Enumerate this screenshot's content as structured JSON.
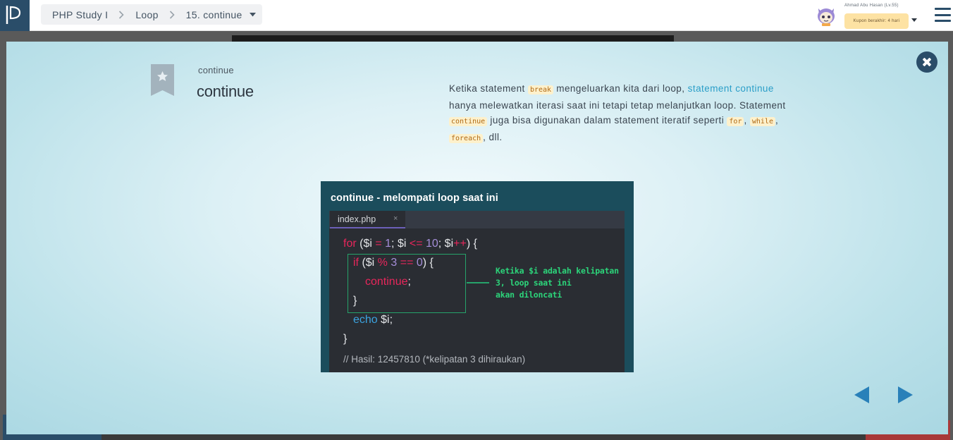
{
  "header": {
    "logo_icon": "progate-logo-icon",
    "breadcrumb": {
      "course": "PHP Study I",
      "section": "Loop",
      "lesson": "15. continue"
    },
    "user": {
      "name": "Ahmad Abu Hasan (Lv.55)",
      "coupon": "Kupon berakhir: 4 hari"
    }
  },
  "card": {
    "caption": "continue",
    "title": "continue",
    "description": {
      "p1": "Ketika statement ",
      "code_break": "break",
      "p2": " mengeluarkan kita dari loop, ",
      "link": "statement continue",
      "p3": " hanya melewatkan iterasi saat ini tetapi tetap melanjutkan loop. Statement ",
      "code_continue": "continue",
      "p4": " juga bisa digunakan dalam statement iteratif seperti ",
      "code_for": "for",
      "sep1": ", ",
      "code_while": "while",
      "sep2": ", ",
      "code_foreach": "foreach",
      "p5": ", dll."
    },
    "slide": {
      "title": "continue - melompati loop saat ini",
      "tab": "index.php",
      "tab_close": "×",
      "code": {
        "l1_for": "for",
        "l1_a": " ($i ",
        "l1_eq": "=",
        "l1_b": " ",
        "l1_1": "1",
        "l1_c": "; $i ",
        "l1_le": "<=",
        "l1_d": " ",
        "l1_10": "10",
        "l1_e": "; $i",
        "l1_pp": "++",
        "l1_f": ") {",
        "l2_if": "if",
        "l2_a": " ($i ",
        "l2_mod": "%",
        "l2_b": " ",
        "l2_3": "3",
        "l2_c": " ",
        "l2_eqeq": "==",
        "l2_d": " ",
        "l2_0": "0",
        "l2_e": ") {",
        "l3_continue": "continue",
        "l3_semi": ";",
        "l4": "}",
        "l5_echo": "echo",
        "l5_rest": " $i;",
        "l6": "}",
        "l7": "// Hasil: 12457810 (*kelipatan 3 dihiraukan)"
      },
      "note": [
        "Ketika $i adalah kelipatan",
        "3, loop saat ini",
        "akan diloncati"
      ]
    }
  },
  "colors": {
    "brand_navy": "#2a4d69",
    "link_blue": "#2a9ec8",
    "nav_arrow": "#2980b9",
    "code_keyword": "#e8265b",
    "code_number": "#a58ed9",
    "code_echo": "#3ba3e0",
    "note_green": "#2cd47a"
  },
  "icons": {
    "bookmark": "bookmark-star-icon",
    "close": "close-circle-icon",
    "prev": "previous-arrow-icon",
    "next": "next-arrow-icon",
    "menu": "hamburger-menu-icon"
  }
}
